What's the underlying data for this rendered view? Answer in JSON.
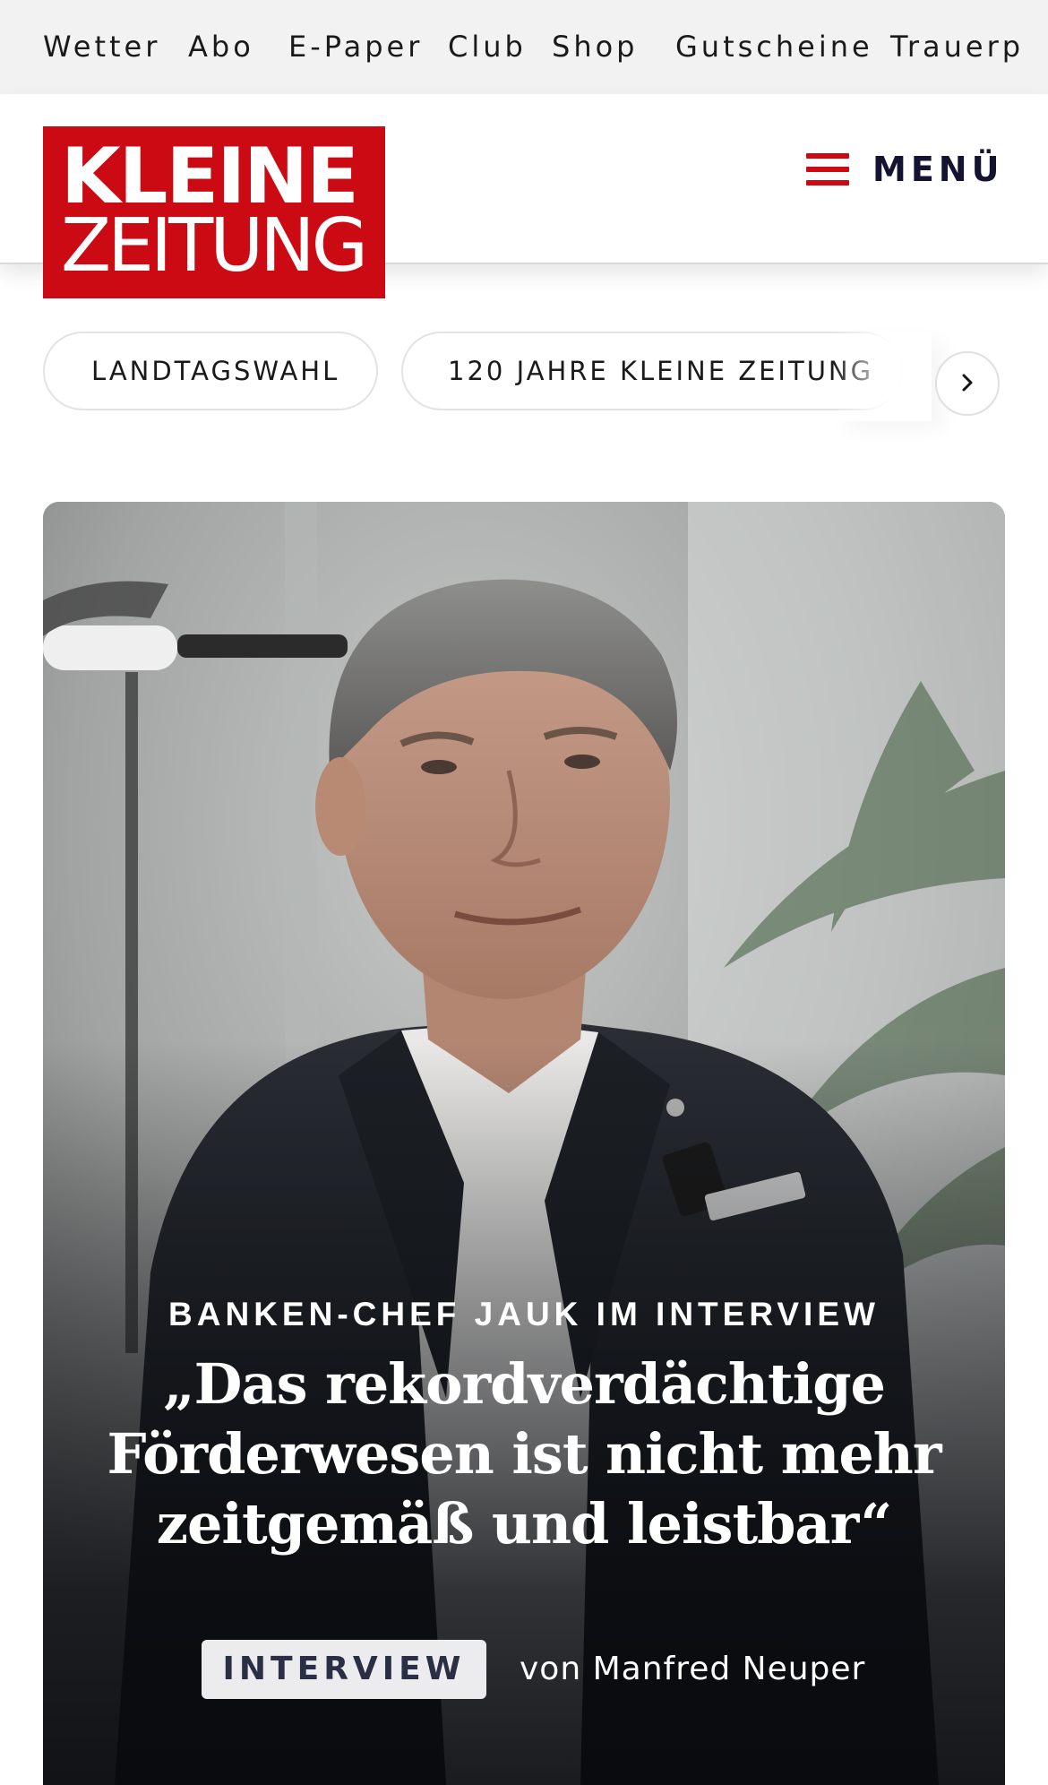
{
  "top_nav": {
    "items": [
      {
        "label": "Wetter"
      },
      {
        "label": "Abo"
      },
      {
        "label": "E-Paper"
      },
      {
        "label": "Club"
      },
      {
        "label": "Shop"
      },
      {
        "label": "Gutscheine"
      },
      {
        "label": "Trauerp"
      }
    ]
  },
  "header": {
    "logo": {
      "line1": "KLEINE",
      "line2": "ZEITUNG"
    },
    "menu_label": "MENÜ"
  },
  "colors": {
    "brand_red": "#cc0a13",
    "menu_text": "#141432",
    "badge_bg": "#ececef",
    "badge_text": "#2a2f45"
  },
  "topics": {
    "chips": [
      {
        "label": "LANDTAGSWAHL"
      },
      {
        "label": "120 JAHRE KLEINE ZEITUNG"
      }
    ],
    "next_icon": "chevron-right-icon"
  },
  "hero": {
    "kicker": "BANKEN-CHEF JAUK IM INTERVIEW",
    "headline": "„Das rekordverdächtige Förderwesen ist nicht mehr zeitgemäß und leistbar“",
    "badge": "INTERVIEW",
    "author": "von Manfred Neuper"
  }
}
